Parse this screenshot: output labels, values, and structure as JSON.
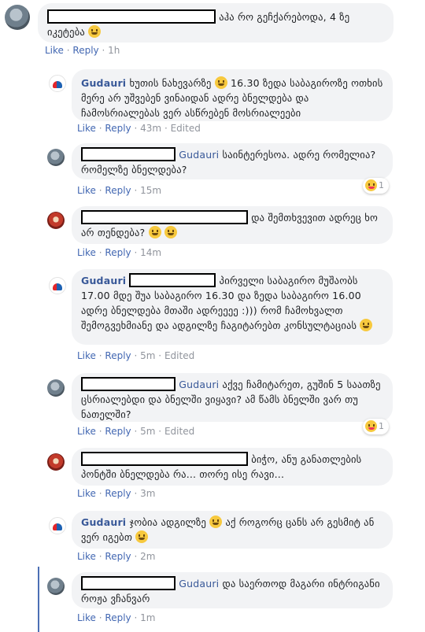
{
  "actions": {
    "like": "Like",
    "reply": "Reply",
    "edited": "Edited",
    "sep": "·"
  },
  "comments": [
    {
      "text": "აჰა რო გეჩქარებოდა, 4 ზე იკეტება",
      "time": "1h"
    },
    {
      "name": "Gudauri",
      "text": "ხუთის ნახევარზე",
      "text2": "16.30 ზედა საბაგიროზე ოთხის მერე არ უშვებენ ვინაიდან ადრე ბნელდება და ჩამოსრიალებას ვერ ასწრებენ მოსრიალეები",
      "time": "43m"
    },
    {
      "tag": "Gudauri",
      "text": "საინტერესოა. ადრე რომელია? რომელზე ბნელდება?",
      "time": "15m",
      "reaction_count": "1"
    },
    {
      "text": "და შემთხვევით ადრეც ხო არ თენდება?",
      "time": "14m"
    },
    {
      "name": "Gudauri",
      "text": "პირველი საბაგირო მუშაობს 17.00 მდე შუა საბაგირო 16.30 და ზედა საბაგირო 16.00 ადრე ბნელდება მთაში ადრეეეე :))) რომ ჩამოხვალთ შემოგვეხმიანე და ადგილზე ჩაგიტარებთ კონსულტაციას",
      "time": "5m"
    },
    {
      "tag": "Gudauri",
      "text": "აქვე ჩამიტარეთ, გუშინ 5 საათზე ცსრიალებდი და ბნელში ვიყავი? ამ წამს ბნელში ვარ თუ ნათელში?",
      "time": "5m",
      "reaction_count": "1"
    },
    {
      "text": "ბიჭო, ანუ განათლების პონტში ბნელდება რა... თორე ისე რავი...",
      "time": "3m"
    },
    {
      "name": "Gudauri",
      "text": "ჯობია ადგილზე",
      "text2": "აქ როგორც ცანს არ გესმიტ ან ვერ იგებთ",
      "time": "2m"
    },
    {
      "tag": "Gudauri",
      "text": "და საერთოდ მაგარი ინტრიგანი როჟა ვჩანვარ",
      "time": "1m"
    }
  ],
  "icons": {
    "smile": "smile-emoji",
    "haha": "haha-emoji",
    "logo": "gudauri-logo"
  }
}
